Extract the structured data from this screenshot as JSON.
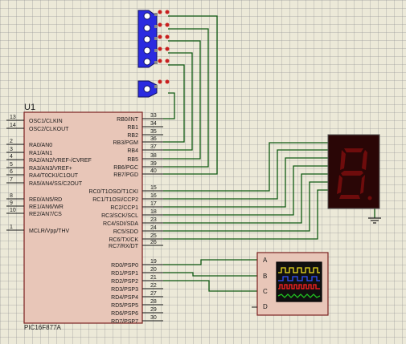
{
  "colors": {
    "wire": "#0f5a12",
    "chip_body": "#e8c6b8",
    "chip_border": "#7a2020",
    "switch_blue": "#2a2ae0",
    "switch_red": "#c81e1e",
    "seg_on": "#c41818",
    "seg_off": "#6e0c0c",
    "scope_body": "#e8c6b8"
  },
  "ic": {
    "ref": "U1",
    "part": "PIC16F877A",
    "left_pins": [
      {
        "num": "13",
        "label": "OSC1/CLKIN"
      },
      {
        "num": "14",
        "label": "OSC2/CLKOUT"
      },
      {
        "num": "2",
        "label": "RA0/AN0"
      },
      {
        "num": "3",
        "label": "RA1/AN1"
      },
      {
        "num": "4",
        "label": "RA2/AN2/VREF-/CVREF"
      },
      {
        "num": "5",
        "label": "RA3/AN3/VREF+"
      },
      {
        "num": "6",
        "label": "RA4/T0CKI/C1OUT"
      },
      {
        "num": "7",
        "label": "RA5/AN4/SS/C2OUT"
      },
      {
        "num": "8",
        "label": "RE0/AN5/RD"
      },
      {
        "num": "9",
        "label": "RE1/AN6/WR"
      },
      {
        "num": "10",
        "label": "RE2/AN7/CS"
      },
      {
        "num": "1",
        "label": "MCLR/Vpp/THV"
      }
    ],
    "right_pins": [
      {
        "num": "33",
        "label": "RB0/INT"
      },
      {
        "num": "34",
        "label": "RB1"
      },
      {
        "num": "35",
        "label": "RB2"
      },
      {
        "num": "36",
        "label": "RB3/PGM"
      },
      {
        "num": "37",
        "label": "RB4"
      },
      {
        "num": "38",
        "label": "RB5"
      },
      {
        "num": "39",
        "label": "RB6/PGC"
      },
      {
        "num": "40",
        "label": "RB7/PGD"
      },
      {
        "num": "15",
        "label": "RC0/T1OSO/T1CKI"
      },
      {
        "num": "16",
        "label": "RC1/T1OSI/CCP2"
      },
      {
        "num": "17",
        "label": "RC2/CCP1"
      },
      {
        "num": "18",
        "label": "RC3/SCK/SCL"
      },
      {
        "num": "23",
        "label": "RC4/SDI/SDA"
      },
      {
        "num": "24",
        "label": "RC5/SDO"
      },
      {
        "num": "25",
        "label": "RC6/TX/CK"
      },
      {
        "num": "26",
        "label": "RC7/RX/DT"
      },
      {
        "num": "19",
        "label": "RD0/PSP0"
      },
      {
        "num": "20",
        "label": "RD1/PSP1"
      },
      {
        "num": "21",
        "label": "RD2/PSP2"
      },
      {
        "num": "22",
        "label": "RD3/PSP3"
      },
      {
        "num": "27",
        "label": "RD4/PSP4"
      },
      {
        "num": "28",
        "label": "RD5/PSP5"
      },
      {
        "num": "29",
        "label": "RD6/PSP6"
      },
      {
        "num": "30",
        "label": "RD7/PSP7"
      }
    ]
  },
  "oscilloscope": {
    "channels": [
      "A",
      "B",
      "C",
      "D"
    ],
    "trace_colors": [
      "#f0e020",
      "#3050ff",
      "#ff2020",
      "#20c020"
    ]
  }
}
